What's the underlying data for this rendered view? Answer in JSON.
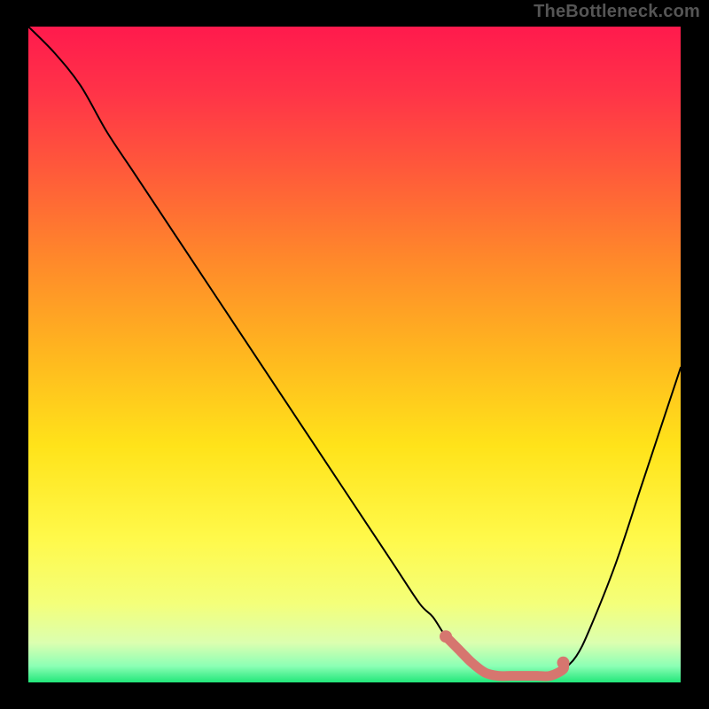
{
  "watermark": "TheBottleneck.com",
  "colors": {
    "page_bg": "#000000",
    "curve": "#000000",
    "band": "#d6766f",
    "gradient_top": "#ff1a4d",
    "gradient_bottom": "#22e77a"
  },
  "chart_data": {
    "type": "line",
    "title": "",
    "xlabel": "",
    "ylabel": "",
    "xlim": [
      0,
      100
    ],
    "ylim": [
      0,
      100
    ],
    "grid": false,
    "legend": false,
    "series": [
      {
        "name": "bottleneck-curve",
        "x": [
          0,
          4,
          8,
          12,
          16,
          20,
          24,
          28,
          32,
          36,
          40,
          44,
          48,
          52,
          56,
          60,
          62,
          64,
          66,
          68,
          70,
          72,
          74,
          76,
          78,
          80,
          82,
          84,
          86,
          90,
          94,
          98,
          100
        ],
        "y": [
          100,
          96,
          91,
          84,
          78,
          72,
          66,
          60,
          54,
          48,
          42,
          36,
          30,
          24,
          18,
          12,
          10,
          7,
          5,
          3,
          1.5,
          1,
          1,
          1,
          1,
          1,
          2,
          4,
          8,
          18,
          30,
          42,
          48
        ]
      }
    ],
    "optimal_band": {
      "x_start": 64,
      "x_end": 82,
      "left_dot": {
        "x": 64,
        "y": 7
      },
      "right_dot": {
        "x": 82,
        "y": 3
      }
    },
    "background_gradient": {
      "direction": "top-to-bottom",
      "stops": [
        {
          "pos": 0.0,
          "color": "#ff1a4d"
        },
        {
          "pos": 0.5,
          "color": "#ffe31a"
        },
        {
          "pos": 0.97,
          "color": "#8cffb5"
        },
        {
          "pos": 1.0,
          "color": "#22e77a"
        }
      ]
    }
  }
}
